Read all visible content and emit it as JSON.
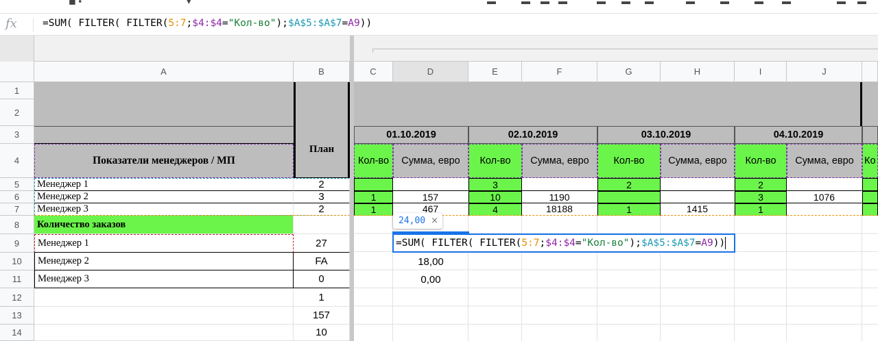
{
  "formula_bar": {
    "fx_label": "fx",
    "parts": [
      "=SUM( FILTER( FILTER(",
      "5:7",
      ";",
      "$4:$4",
      "=",
      "\"Кол-во\"",
      ");",
      "$A$5:$A$7",
      "=",
      "A9",
      "))"
    ]
  },
  "columns": [
    "A",
    "B",
    "C",
    "D",
    "E",
    "F",
    "G",
    "H",
    "I",
    "J"
  ],
  "rows": [
    "1",
    "2",
    "3",
    "4",
    "5",
    "6",
    "7",
    "8",
    "9",
    "10",
    "11",
    "12",
    "13",
    "14"
  ],
  "header": {
    "title": "Показатели менеджеров / МП",
    "plan": "План",
    "dates": [
      "01.10.2019",
      "02.10.2019",
      "03.10.2019",
      "04.10.2019"
    ],
    "qty_short": "Кол-во",
    "qty": "Кол-во",
    "sum": "Сумма, евро",
    "partial": "Ко"
  },
  "managers": [
    {
      "name": "Менеджер 1",
      "plan": "2",
      "c": "",
      "d": "",
      "e": "3",
      "f": "",
      "g": "2",
      "h": "",
      "i": "2",
      "j": ""
    },
    {
      "name": "Менеджер 2",
      "plan": "3",
      "c": "1",
      "d": "157",
      "e": "10",
      "f": "1190",
      "g": "",
      "h": "",
      "i": "3",
      "j": "1076"
    },
    {
      "name": "Менеджер 3",
      "plan": "2",
      "c": "1",
      "d": "467",
      "e": "4",
      "f": "18188",
      "g": "1",
      "h": "1415",
      "i": "1",
      "j": ""
    }
  ],
  "orders": {
    "title": "Количество заказов",
    "rows": [
      {
        "name": "Менеджер 1",
        "b": "27",
        "d": ""
      },
      {
        "name": "Менеджер 2",
        "b": "FA",
        "d": "18,00"
      },
      {
        "name": "Менеджер 3",
        "b": "0",
        "d": "0,00"
      }
    ],
    "extra_b": [
      "1",
      "157",
      "10"
    ]
  },
  "editor": {
    "chip_value": "24,00",
    "chip_close": "×",
    "parts": [
      "=SUM( FILTER( FILTER(",
      "5:7",
      ";",
      "$4:$4",
      "=",
      "\"Кол-во\"",
      ");",
      "$A$5:$A$7",
      "=",
      "A9",
      "))"
    ]
  },
  "colors": {
    "green": "#6bf54b",
    "gray": "#bdbdbd",
    "accent": "#1a73e8"
  }
}
